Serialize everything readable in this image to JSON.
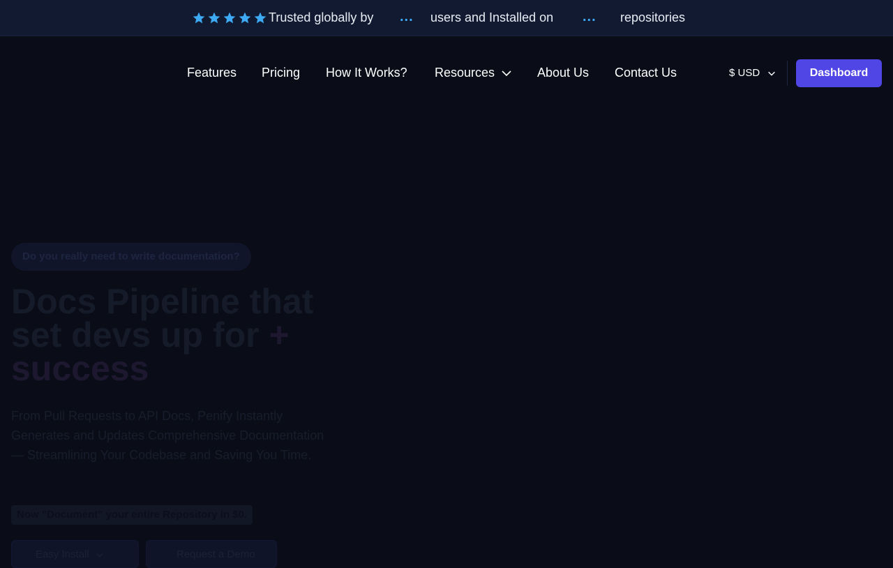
{
  "announcement": {
    "rating_stars": 5,
    "star_color": "#3ea9f5",
    "text_before": "Trusted globally by",
    "users_count": "...",
    "text_middle": "users and Installed on",
    "repos_count": "...",
    "text_after": "repositories"
  },
  "nav": {
    "items": [
      {
        "label": "Features"
      },
      {
        "label": "Pricing"
      },
      {
        "label": "How It Works?"
      },
      {
        "label": "Resources",
        "icon": "chevron-down-icon"
      },
      {
        "label": "About Us"
      },
      {
        "label": "Contact Us"
      }
    ],
    "currency": "$ USD",
    "dashboard_label": "Dashboard",
    "accent_color": "#4f46e5"
  },
  "hero": {
    "badge": "Do you really need to write documentation?",
    "headline_line1": "Docs Pipeline that",
    "headline_line2": "set devs up for",
    "headline_plus": "+",
    "headline_line3": "success",
    "subtitle": "From Pull Requests to API Docs, Penify Instantly Generates and Updates Comprehensive Documentation — Streamlining Your Codebase and Saving You Time.",
    "promo": "Now \"Document\" your entire Repository in $0.",
    "install_label": "Easy Install",
    "demo_label": "Request a Demo"
  }
}
